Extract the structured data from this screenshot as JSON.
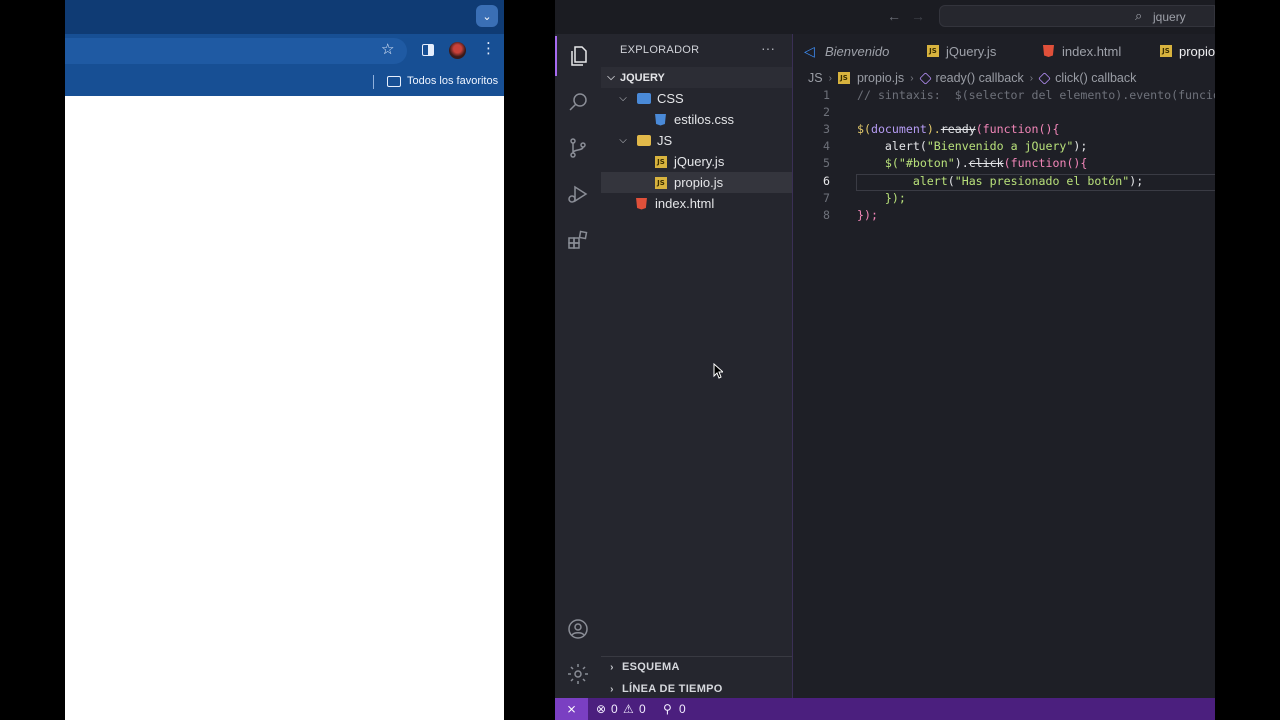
{
  "browser": {
    "bookmarks_label": "Todos los favoritos"
  },
  "vscode": {
    "search_text": "jquery",
    "explorer_title": "EXPLORADOR",
    "more_label": "···",
    "root_folder": "JQUERY",
    "tree": [
      {
        "label": "CSS",
        "type": "folder"
      },
      {
        "label": "estilos.css",
        "type": "css-file"
      },
      {
        "label": "JS",
        "type": "folder"
      },
      {
        "label": "jQuery.js",
        "type": "js-file"
      },
      {
        "label": "propio.js",
        "type": "js-file",
        "selected": true
      },
      {
        "label": "index.html",
        "type": "html-file"
      }
    ],
    "outline_label": "ESQUEMA",
    "timeline_label": "LÍNEA DE TIEMPO",
    "tabs": [
      {
        "label": "Bienvenido",
        "icon": "vscode-icon"
      },
      {
        "label": "jQuery.js",
        "icon": "js-file-icon"
      },
      {
        "label": "index.html",
        "icon": "html-file-icon"
      },
      {
        "label": "propio",
        "icon": "js-file-icon",
        "active": true
      }
    ],
    "breadcrumbs": {
      "folder": "JS",
      "file": "propio.js",
      "symbol1": "ready() callback",
      "symbol2": "click() callback"
    },
    "line_numbers": [
      "1",
      "2",
      "3",
      "4",
      "5",
      "6",
      "7",
      "8"
    ],
    "current_line": 6,
    "code": {
      "l1": "// sintaxis:  $(selector del elemento).evento(funcio",
      "l3_a": "$(",
      "l3_b": "document",
      "l3_c": ").",
      "l3_d": "ready",
      "l3_e": "(",
      "l3_f": "function",
      "l3_g": "(){",
      "l4_a": "    ",
      "l4_b": "alert",
      "l4_c": "(",
      "l4_d": "\"Bienvenido a jQuery\"",
      "l4_e": ");",
      "l5_a": "    $(",
      "l5_b": "\"#boton\"",
      "l5_c": ").",
      "l5_d": "click",
      "l5_e": "(",
      "l5_f": "function",
      "l5_g": "(){",
      "l6_a": "        ",
      "l6_b": "alert",
      "l6_c": "(",
      "l6_d": "\"Has presionado el botón\"",
      "l6_e": ");",
      "l7": "    });",
      "l8": "});"
    },
    "status": {
      "errors": "0",
      "warnings": "0",
      "ports": "0"
    }
  }
}
